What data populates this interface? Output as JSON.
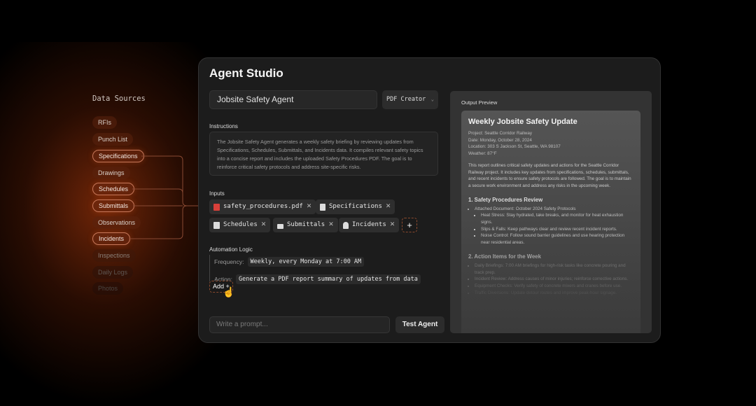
{
  "sidebar": {
    "title": "Data Sources",
    "items": [
      {
        "label": "RFIs",
        "selected": false
      },
      {
        "label": "Punch List",
        "selected": false
      },
      {
        "label": "Specifications",
        "selected": true
      },
      {
        "label": "Drawings",
        "selected": false
      },
      {
        "label": "Schedules",
        "selected": true
      },
      {
        "label": "Submittals",
        "selected": true
      },
      {
        "label": "Observations",
        "selected": false
      },
      {
        "label": "Incidents",
        "selected": true
      },
      {
        "label": "Inspections",
        "selected": false
      },
      {
        "label": "Daily Logs",
        "selected": false
      },
      {
        "label": "Photos",
        "selected": false
      }
    ]
  },
  "app": {
    "title": "Agent Studio"
  },
  "agent": {
    "name": "Jobsite Safety Agent",
    "type": "PDF Creator"
  },
  "instructions": {
    "label": "Instructions",
    "text": "The Jobsite Safety Agent generates a weekly safety briefing by reviewing updates from Specifications, Schedules, Submittals, and Incidents data. It compiles relevant safety topics into a concise report and includes the uploaded Safety Procedures PDF. The goal is to reinforce critical safety protocols and address site-specific risks."
  },
  "inputs": {
    "label": "Inputs",
    "chips": [
      {
        "label": "safety_procedures.pdf",
        "icon": "pdf-file-icon"
      },
      {
        "label": "Specifications",
        "icon": "document-icon"
      },
      {
        "label": "Schedules",
        "icon": "calendar-icon"
      },
      {
        "label": "Submittals",
        "icon": "upload-tray-icon"
      },
      {
        "label": "Incidents",
        "icon": "alarm-icon"
      }
    ],
    "add": "+"
  },
  "logic": {
    "label": "Automation Logic",
    "frequency_label": "Frequency:",
    "frequency": "Weekly, every Monday at 7:00 AM",
    "action_label": "Action:",
    "action": "Generate a PDF report summary of updates from data",
    "add": "Add +"
  },
  "prompt": {
    "placeholder": "Write a prompt..."
  },
  "test_button": "Test Agent",
  "preview": {
    "label": "Output Preview",
    "title": "Weekly Jobsite Safety Update",
    "meta": [
      "Project: Seattle Corridor Railway",
      "Date: Monday, October 28, 2024",
      "Location: 303 S Jackson St, Seattle, WA 98107",
      "Weather: 87°F"
    ],
    "intro": "This report outlines critical safety updates and actions for the Seattle Corridor Railway project. It includes key updates from specifications, schedules, submittals, and recent incidents to ensure safety protocols are followed. The goal is to maintain a secure work environment and address any risks in the upcoming week.",
    "s1": "1. Safety Procedures Review",
    "s1_item": "Attached Document: October 2024 Safety Protocols",
    "s1_sub": [
      "Heat Stress: Stay hydrated, take breaks, and monitor for heat exhaustion signs.",
      "Slips & Falls: Keep pathways clear and review recent incident reports.",
      "Noise Control: Follow sound barrier guidelines and use hearing protection near residential areas."
    ],
    "s2": "2. Action Items for the Week",
    "s2_items": [
      "Daily Briefings: 7:00 AM briefings for high-risk tasks like concrete pouring and track prep.",
      "Incident Review: Address causes of minor injuries; reinforce corrective actions.",
      "Equipment Checks: Verify safety of concrete mixers and cranes before use.",
      "Traffic Diversions: Update detour routes and improve peak-hour signage."
    ]
  },
  "colors": {
    "accent": "#c7785a",
    "pdf": "#d9403a",
    "window": "#1c1c1c"
  }
}
